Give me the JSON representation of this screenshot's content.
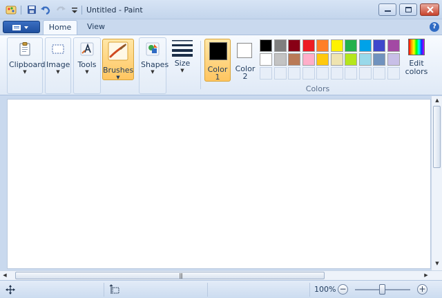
{
  "window": {
    "title": "Untitled - Paint"
  },
  "tabs": [
    {
      "label": "Home"
    },
    {
      "label": "View"
    }
  ],
  "help_label": "?",
  "ribbon": {
    "clipboard_label": "Clipboard",
    "image_label": "Image",
    "tools_label": "Tools",
    "brushes_label": "Brushes",
    "shapes_label": "Shapes",
    "size_label": "Size",
    "color1_label": "Color\n1",
    "color1_line1": "Color",
    "color1_line2": "1",
    "color2_line1": "Color",
    "color2_line2": "2",
    "colors_group_label": "Colors",
    "edit_colors_line1": "Edit",
    "edit_colors_line2": "colors",
    "color1_value": "#000000",
    "color2_value": "#ffffff",
    "palette_row1": [
      "#000000",
      "#7f7f7f",
      "#880015",
      "#ed1c24",
      "#ff7f27",
      "#fff200",
      "#22b14c",
      "#00a2e8",
      "#3f48cc",
      "#a349a4"
    ],
    "palette_row2": [
      "#ffffff",
      "#c3c3c3",
      "#b97a57",
      "#ffaec9",
      "#ffc90e",
      "#efe4b0",
      "#b5e61d",
      "#99d9ea",
      "#7092be",
      "#c8bfe7"
    ]
  },
  "statusbar": {
    "zoom": "100%",
    "zoom_out": "−",
    "zoom_in": "+"
  }
}
